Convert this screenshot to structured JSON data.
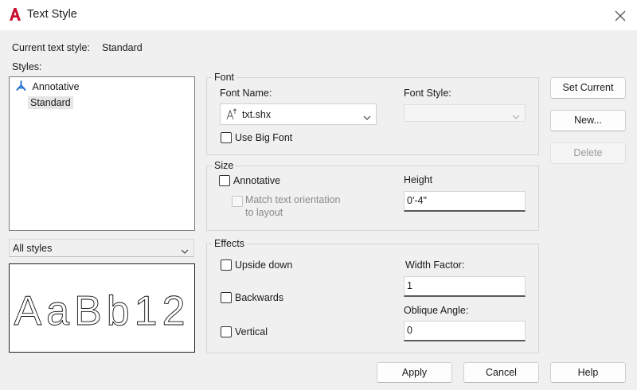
{
  "window": {
    "title": "Text Style",
    "close_icon": "close-icon",
    "app_icon": "autocad-a-icon",
    "accent_color": "#c8102e"
  },
  "current_style": {
    "label": "Current text style:",
    "value": "Standard"
  },
  "styles": {
    "label": "Styles:",
    "items": [
      {
        "label": "Annotative",
        "icon": "annotative-icon"
      },
      {
        "label": "Standard",
        "selected": true
      }
    ],
    "filter_value": "All styles"
  },
  "preview": {
    "text": "AaBb12"
  },
  "font": {
    "group_label": "Font",
    "font_name_label": "Font Name:",
    "font_name_value": "txt.shx",
    "font_name_icon": "shx-font-icon",
    "font_style_label": "Font Style:",
    "font_style_value": "",
    "use_big_font_label": "Use Big Font",
    "use_big_font_checked": false
  },
  "size": {
    "group_label": "Size",
    "annotative_label": "Annotative",
    "annotative_checked": false,
    "match_orientation_line1": "Match text orientation",
    "match_orientation_line2": "to layout",
    "height_label": "Height",
    "height_value": "0'-4\""
  },
  "effects": {
    "group_label": "Effects",
    "upside_down_label": "Upside down",
    "backwards_label": "Backwards",
    "vertical_label": "Vertical",
    "width_factor_label": "Width Factor:",
    "width_factor_value": "1",
    "oblique_angle_label": "Oblique Angle:",
    "oblique_angle_value": "0"
  },
  "buttons": {
    "set_current": "Set Current",
    "new": "New...",
    "delete": "Delete",
    "apply": "Apply",
    "cancel": "Cancel",
    "help": "Help"
  }
}
